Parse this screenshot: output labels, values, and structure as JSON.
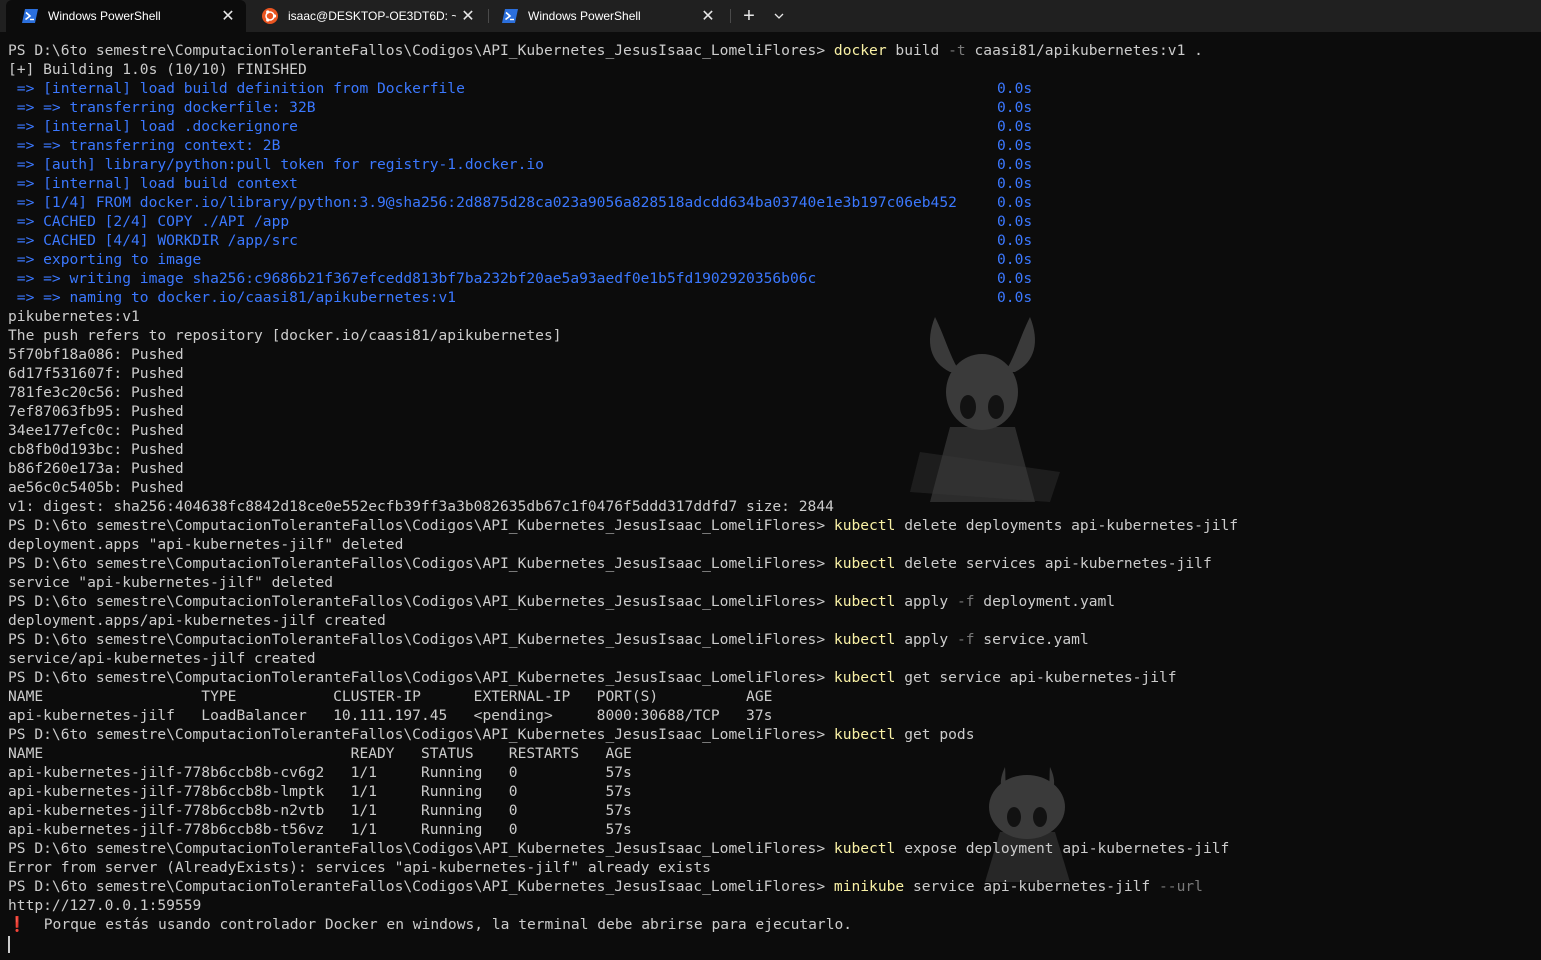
{
  "tabs": [
    {
      "label": "Windows PowerShell",
      "icon": "powershell-icon"
    },
    {
      "label": "isaac@DESKTOP-OE3DT6D: ~",
      "icon": "ubuntu-icon"
    },
    {
      "label": "Windows PowerShell",
      "icon": "powershell-icon"
    }
  ],
  "tabbar": {
    "new_tab_label": "+",
    "dropdown_icon": "chevron-down-icon"
  },
  "prompt": "PS D:\\6to semestre\\ComputacionToleranteFallos\\Codigos\\API_Kubernetes_JesusIsaac_LomeliFlores> ",
  "commands": {
    "build": {
      "cmd": "docker",
      "args1": " build ",
      "flag": "-t",
      "args2": " caasi81/apikubernetes:v1 ."
    },
    "delete_deploy": {
      "cmd": "kubectl",
      "args": " delete deployments api-kubernetes-jilf"
    },
    "delete_svc": {
      "cmd": "kubectl",
      "args": " delete services api-kubernetes-jilf"
    },
    "apply_deploy": {
      "cmd": "kubectl",
      "args1": " apply ",
      "flag": "-f",
      "args2": " deployment.yaml"
    },
    "apply_svc": {
      "cmd": "kubectl",
      "args1": " apply ",
      "flag": "-f",
      "args2": " service.yaml"
    },
    "get_svc": {
      "cmd": "kubectl",
      "args": " get service api-kubernetes-jilf"
    },
    "get_pods": {
      "cmd": "kubectl",
      "args": " get pods"
    },
    "expose": {
      "cmd": "kubectl",
      "args": " expose deployment api-kubernetes-jilf"
    },
    "minikube": {
      "cmd": "minikube",
      "args": " service api-kubernetes-jilf ",
      "flag": "--url"
    }
  },
  "build_header": "[+] Building 1.0s (10/10) FINISHED",
  "build_steps": [
    {
      "text": " => [internal] load build definition from Dockerfile",
      "time": "0.0s"
    },
    {
      "text": " => => transferring dockerfile: 32B",
      "time": "0.0s"
    },
    {
      "text": " => [internal] load .dockerignore",
      "time": "0.0s"
    },
    {
      "text": " => => transferring context: 2B",
      "time": "0.0s"
    },
    {
      "text": " => [auth] library/python:pull token for registry-1.docker.io",
      "time": "0.0s"
    },
    {
      "text": " => [internal] load build context",
      "time": "0.0s"
    },
    {
      "text": " => [1/4] FROM docker.io/library/python:3.9@sha256:2d8875d28ca023a9056a828518adcdd634ba03740e1e3b197c06eb452",
      "time": "0.0s"
    },
    {
      "text": " => CACHED [2/4] COPY ./API /app",
      "time": "0.0s"
    },
    {
      "text": " => CACHED [4/4] WORKDIR /app/src",
      "time": "0.0s"
    },
    {
      "text": " => exporting to image",
      "time": "0.0s"
    },
    {
      "text": " => => writing image sha256:c9686b21f367efcedd813bf7ba232bf20ae5a93aedf0e1b5fd1902920356b06c",
      "time": "0.0s"
    },
    {
      "text": " => => naming to docker.io/caasi81/apikubernetes:v1",
      "time": "0.0s"
    }
  ],
  "push_output": [
    "pikubernetes:v1",
    "The push refers to repository [docker.io/caasi81/apikubernetes]",
    "5f70bf18a086: Pushed",
    "6d17f531607f: Pushed",
    "781fe3c20c56: Pushed",
    "7ef87063fb95: Pushed",
    "34ee177efc0c: Pushed",
    "cb8fb0d193bc: Pushed",
    "b86f260e173a: Pushed",
    "ae56c0c5405b: Pushed",
    "v1: digest: sha256:404638fc8842d18ce0e552ecfb39ff3a3b082635db67c1f0476f5ddd317ddfd7 size: 2844"
  ],
  "outputs": {
    "delete_deploy": "deployment.apps \"api-kubernetes-jilf\" deleted",
    "delete_svc": "service \"api-kubernetes-jilf\" deleted",
    "apply_deploy": "deployment.apps/api-kubernetes-jilf created",
    "apply_svc": "service/api-kubernetes-jilf created",
    "expose_error": "Error from server (AlreadyExists): services \"api-kubernetes-jilf\" already exists",
    "url": "http://127.0.0.1:59559",
    "warning_icon": "❗",
    "warning_text": "  Porque estás usando controlador Docker en windows, la terminal debe abrirse para ejecutarlo."
  },
  "service_table": [
    "NAME                  TYPE           CLUSTER-IP      EXTERNAL-IP   PORT(S)          AGE",
    "api-kubernetes-jilf   LoadBalancer   10.111.197.45   <pending>     8000:30688/TCP   37s"
  ],
  "pods_table": [
    "NAME                                   READY   STATUS    RESTARTS   AGE",
    "api-kubernetes-jilf-778b6ccb8b-cv6g2   1/1     Running   0          57s",
    "api-kubernetes-jilf-778b6ccb8b-lmptk   1/1     Running   0          57s",
    "api-kubernetes-jilf-778b6ccb8b-n2vtb   1/1     Running   0          57s",
    "api-kubernetes-jilf-778b6ccb8b-t56vz   1/1     Running   0          57s"
  ],
  "colors": {
    "background": "#0c0c0c",
    "tabbar": "#202020",
    "foreground": "#cccccc",
    "command": "#f9f1a5",
    "flag": "#7a7a7a",
    "build_text": "#3b78ff",
    "warning": "#e74856"
  }
}
